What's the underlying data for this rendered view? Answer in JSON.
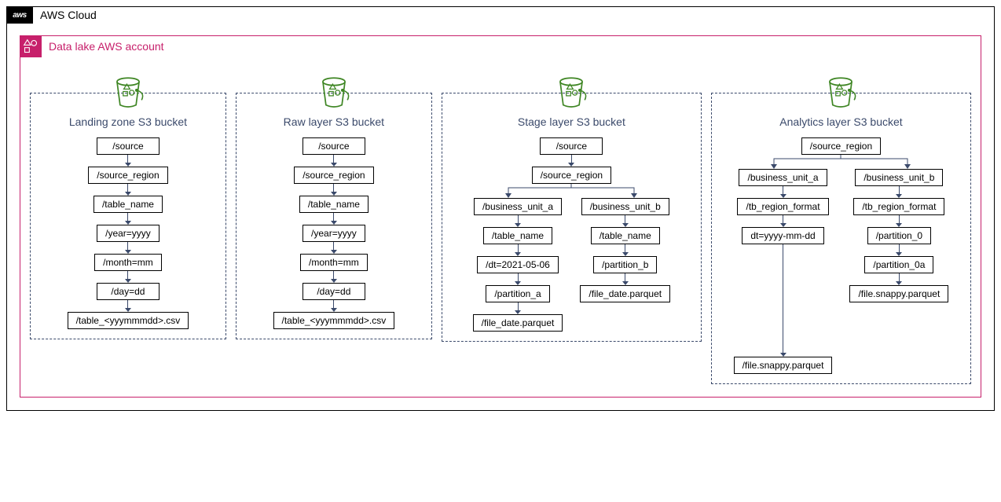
{
  "cloud": {
    "label": "AWS Cloud",
    "aws_logo_text": "aws"
  },
  "account": {
    "label": "Data lake AWS account"
  },
  "buckets": {
    "landing": {
      "title": "Landing zone S3 bucket",
      "paths": [
        "/source",
        "/source_region",
        "/table_name",
        "/year=yyyy",
        "/month=mm",
        "/day=dd",
        "/table_<yyymmmdd>.csv"
      ]
    },
    "raw": {
      "title": "Raw layer S3 bucket",
      "paths": [
        "/source",
        "/source_region",
        "/table_name",
        "/year=yyyy",
        "/month=mm",
        "/day=dd",
        "/table_<yyymmmdd>.csv"
      ]
    },
    "stage": {
      "title": "Stage layer S3 bucket",
      "head": [
        "/source",
        "/source_region"
      ],
      "left": [
        "/business_unit_a",
        "/table_name",
        "/dt=2021-05-06",
        "/partition_a",
        "/file_date.parquet"
      ],
      "right": [
        "/business_unit_b",
        "/table_name",
        "/partition_b",
        "/file_date.parquet"
      ]
    },
    "analytics": {
      "title": "Analytics layer S3 bucket",
      "head": [
        "/source_region"
      ],
      "left": [
        "/business_unit_a",
        "/tb_region_format",
        "dt=yyyy-mm-dd",
        "/file.snappy.parquet"
      ],
      "right": [
        "/business_unit_b",
        "/tb_region_format",
        "/partition_0",
        "/partition_0a",
        "/file.snappy.parquet"
      ]
    }
  }
}
